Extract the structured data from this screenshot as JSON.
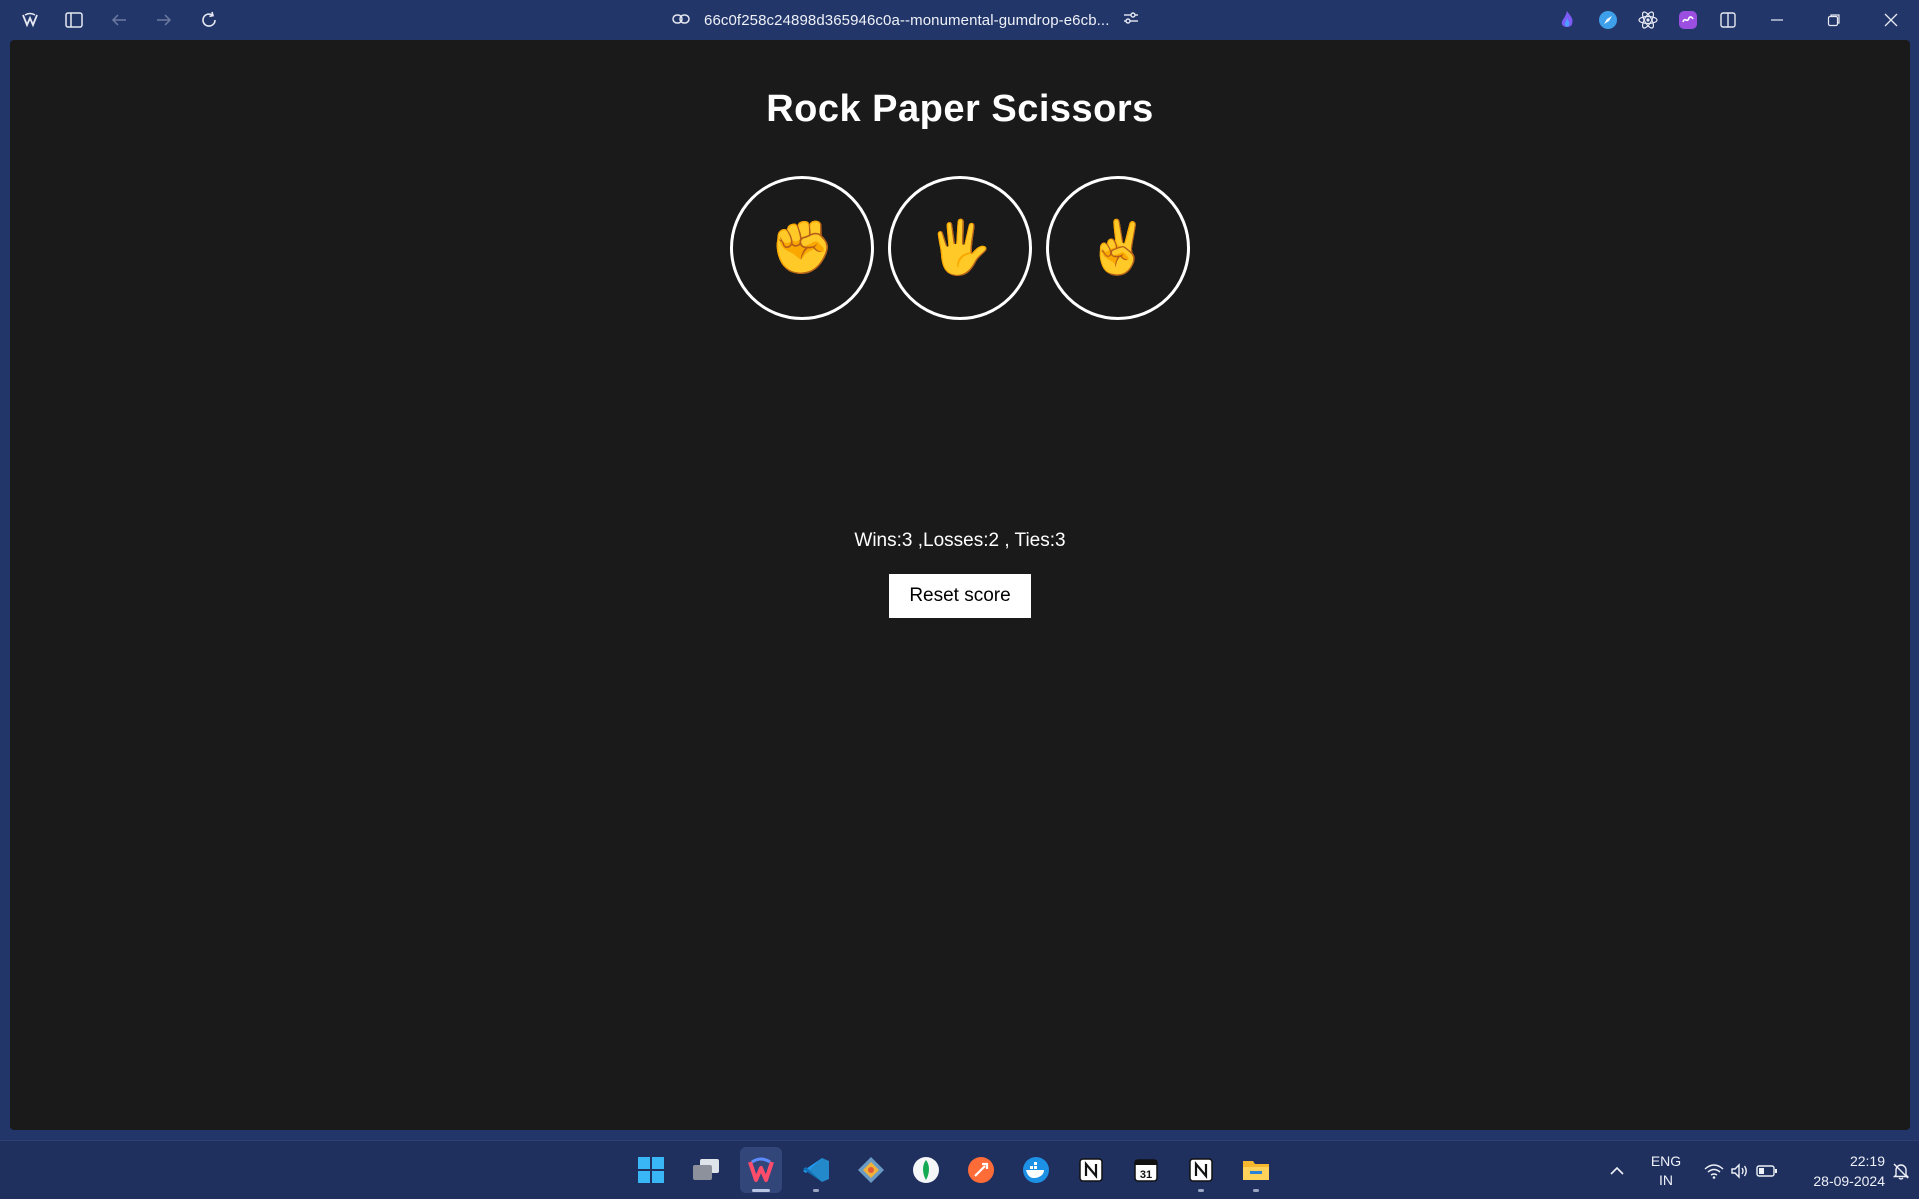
{
  "browser": {
    "url": "66c0f258c24898d365946c0a--monumental-gumdrop-e6cb...",
    "accent": "#23366a"
  },
  "game": {
    "title": "Rock Paper Scissors",
    "moves": [
      {
        "label": "✊",
        "icon": "rock-fist-icon"
      },
      {
        "label": "🖐",
        "icon": "paper-hand-icon"
      },
      {
        "label": "✌",
        "icon": "scissors-victory-icon"
      }
    ],
    "score_text": "Wins:3 ,Losses:2 , Ties:3",
    "reset_label": "Reset score"
  },
  "taskbar": {
    "language_line1": "ENG",
    "language_line2": "IN",
    "time": "22:19",
    "date": "28-09-2024"
  }
}
